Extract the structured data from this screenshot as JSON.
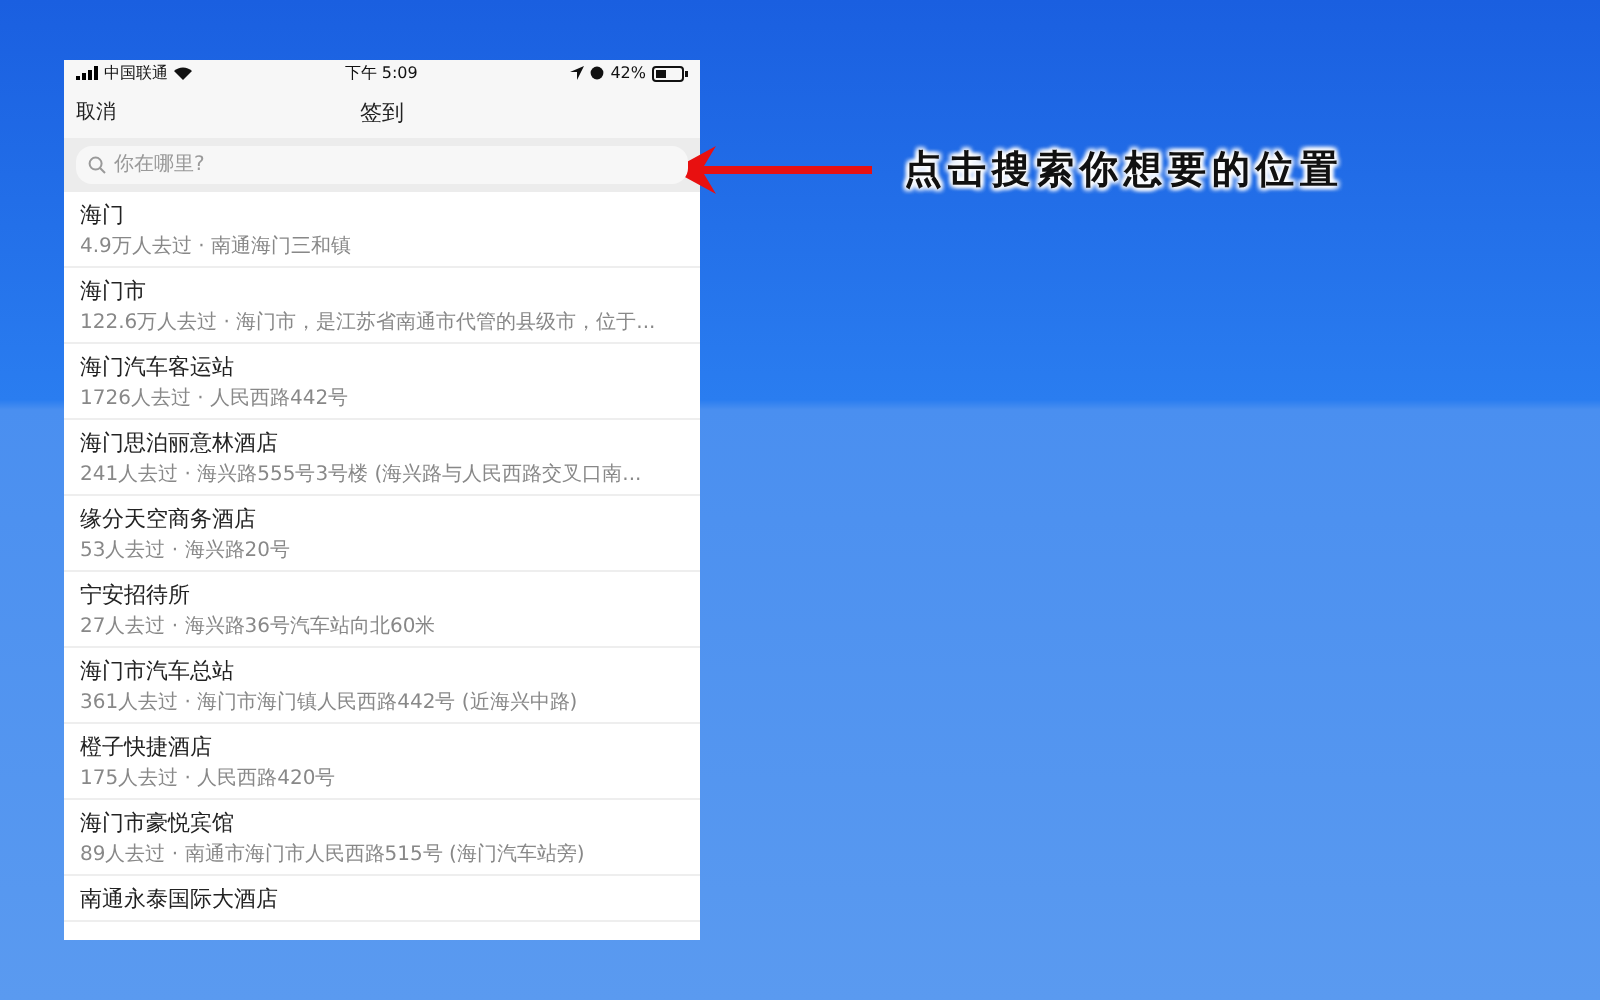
{
  "status_bar": {
    "carrier": "中国联通",
    "time": "下午 5:09",
    "battery": "42%"
  },
  "nav": {
    "cancel": "取消",
    "title": "签到"
  },
  "search": {
    "placeholder": "你在哪里?"
  },
  "places": [
    {
      "name": "海门",
      "detail": "4.9万人去过 · 南通海门三和镇"
    },
    {
      "name": "海门市",
      "detail": "122.6万人去过 · 海门市，是江苏省南通市代管的县级市，位于..."
    },
    {
      "name": "海门汽车客运站",
      "detail": "1726人去过 · 人民西路442号"
    },
    {
      "name": "海门思泊丽意林酒店",
      "detail": "241人去过 · 海兴路555号3号楼 (海兴路与人民西路交叉口南..."
    },
    {
      "name": "缘分天空商务酒店",
      "detail": "53人去过 · 海兴路20号"
    },
    {
      "name": "宁安招待所",
      "detail": "27人去过 · 海兴路36号汽车站向北60米"
    },
    {
      "name": "海门市汽车总站",
      "detail": "361人去过 · 海门市海门镇人民西路442号 (近海兴中路)"
    },
    {
      "name": "橙子快捷酒店",
      "detail": "175人去过 · 人民西路420号"
    },
    {
      "name": "海门市豪悦宾馆",
      "detail": "89人去过 · 南通市海门市人民西路515号 (海门汽车站旁)"
    },
    {
      "name": "南通永泰国际大酒店"
    }
  ],
  "callout": "点击搜索你想要的位置"
}
